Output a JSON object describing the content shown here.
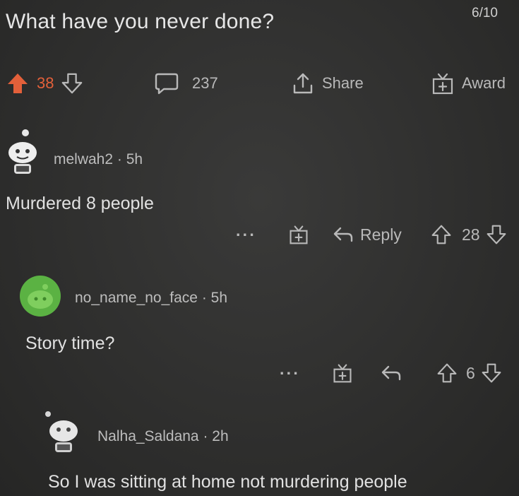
{
  "counter": "6/10",
  "post": {
    "title": "What have you never done?",
    "upvotes": "38",
    "comments": "237",
    "share_label": "Share",
    "award_label": "Award"
  },
  "comments": [
    {
      "username": "melwah2",
      "age": "5h",
      "text": "Murdered 8 people",
      "more": "···",
      "reply_label": "Reply",
      "score": "28"
    },
    {
      "username": "no_name_no_face",
      "age": "5h",
      "text": "Story time?",
      "more": "···",
      "score": "6"
    },
    {
      "username": "Nalha_Saldana",
      "age": "2h",
      "text": "So I was sitting at home not murdering people"
    }
  ],
  "colors": {
    "background": "#2e2e2d",
    "upvote_active": "#e3603a",
    "avatar_green": "#5bb243",
    "text": "#e1e1e1",
    "muted": "#b9b9b9"
  }
}
